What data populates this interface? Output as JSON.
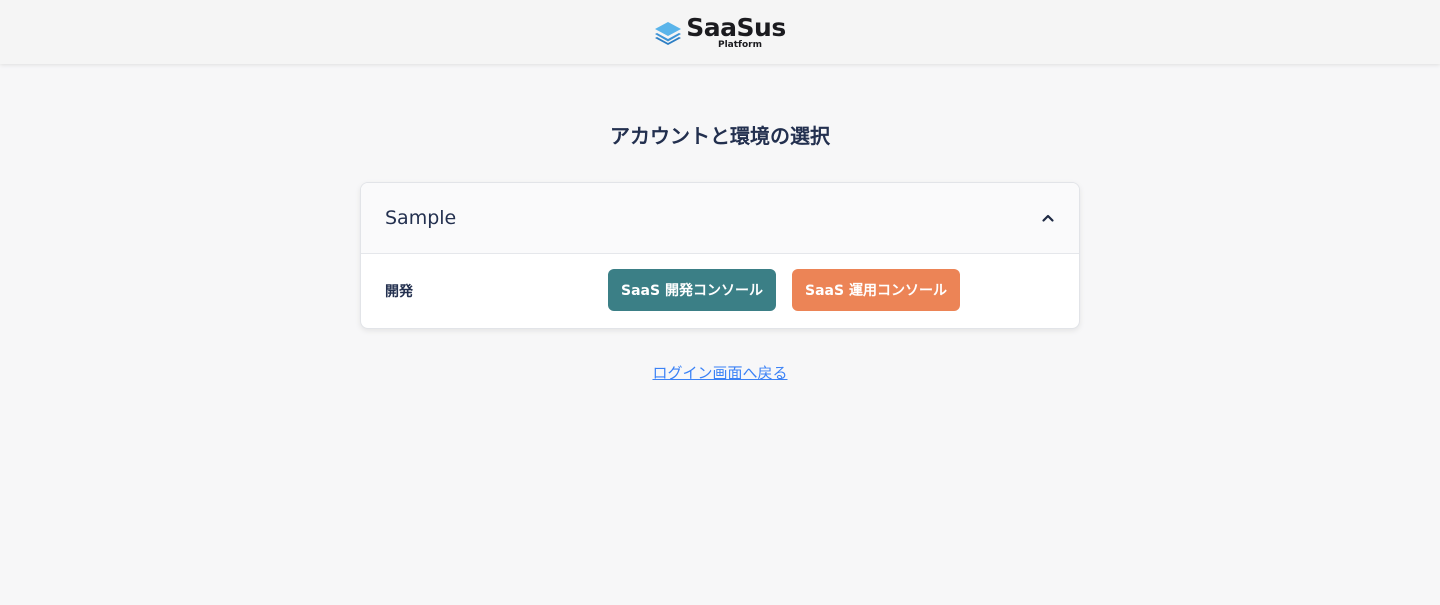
{
  "header": {
    "logo_word": "SaaSus",
    "logo_sub": "Platform",
    "logo_icon": "layers-icon",
    "logo_color": "#5ab4ea"
  },
  "main": {
    "title": "アカウントと環境の選択"
  },
  "card": {
    "title": "Sample",
    "expanded": true,
    "toggle_icon": "chevron-up-icon",
    "environments": [
      {
        "label": "開発",
        "dev_console_label": "SaaS 開発コンソール",
        "ops_console_label": "SaaS 運用コンソール"
      }
    ]
  },
  "back_link": {
    "label": "ログイン画面へ戻る"
  },
  "colors": {
    "dev_button": "#3b7f86",
    "ops_button": "#ec8456",
    "link": "#3b82f6",
    "text": "#23304f"
  }
}
